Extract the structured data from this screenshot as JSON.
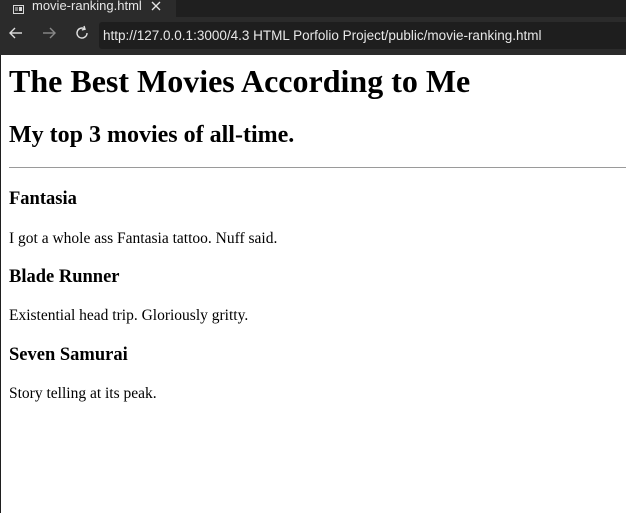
{
  "browser": {
    "tab": {
      "title": "movie-ranking.html",
      "icon": "document-icon",
      "close_icon": "close-icon"
    },
    "nav": {
      "back_icon": "back-arrow-icon",
      "forward_icon": "forward-arrow-icon",
      "reload_icon": "reload-icon"
    },
    "address": {
      "url": "http://127.0.0.1:3000/4.3 HTML Porfolio Project/public/movie-ranking.html"
    },
    "colors": {
      "chrome_dark": "#1f1f1f",
      "toolbar": "#2b2b2b",
      "address_bg": "#1e1e1e",
      "text_light": "#e8e8e8"
    }
  },
  "page": {
    "heading": "The Best Movies According to Me",
    "subheading": "My top 3 movies of all-time.",
    "movies": [
      {
        "title": "Fantasia",
        "description": "I got a whole ass Fantasia tattoo. Nuff said."
      },
      {
        "title": "Blade Runner",
        "description": "Existential head trip. Gloriously gritty."
      },
      {
        "title": "Seven Samurai",
        "description": "Story telling at its peak."
      }
    ]
  }
}
